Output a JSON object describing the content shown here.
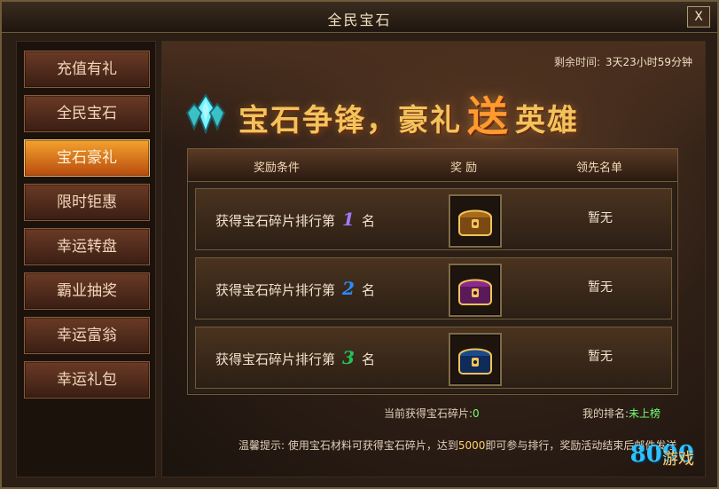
{
  "window": {
    "title": "全民宝石",
    "close_label": "X"
  },
  "sidebar": {
    "items": [
      {
        "label": "充值有礼"
      },
      {
        "label": "全民宝石"
      },
      {
        "label": "宝石豪礼"
      },
      {
        "label": "限时钜惠"
      },
      {
        "label": "幸运转盘"
      },
      {
        "label": "霸业抽奖"
      },
      {
        "label": "幸运富翁"
      },
      {
        "label": "幸运礼包"
      }
    ],
    "active_label": "宝石豪礼"
  },
  "event": {
    "remaining_label": "剩余时间:",
    "remaining_value": "3天23小时59分钟",
    "banner": {
      "left": "宝石争锋，豪礼",
      "emphasis": "送",
      "right": "英雄"
    }
  },
  "rank": {
    "headers": {
      "condition": "奖励条件",
      "reward": "奖 励",
      "leader": "领先名单"
    },
    "rows": [
      {
        "prefix": "获得宝石碎片排行第",
        "rank": "1",
        "suffix": "名",
        "leader": "暂无",
        "reward_icon": "gold-chest-icon",
        "rank_color": "#a07bff"
      },
      {
        "prefix": "获得宝石碎片排行第",
        "rank": "2",
        "suffix": "名",
        "leader": "暂无",
        "reward_icon": "purple-chest-icon",
        "rank_color": "#2a8bff"
      },
      {
        "prefix": "获得宝石碎片排行第",
        "rank": "3",
        "suffix": "名",
        "leader": "暂无",
        "reward_icon": "blue-chest-icon",
        "rank_color": "#22c35a"
      }
    ]
  },
  "footer": {
    "current_label": "当前获得宝石碎片:",
    "current_value": "0",
    "my_rank_label": "我的排名:",
    "my_rank_value": "未上榜",
    "tips_prefix": "温馨提示: 使用宝石材料可获得宝石碎片，达到",
    "tips_value": "5000",
    "tips_suffix": "即可参与排行，奖励活动结束后邮件发送"
  },
  "watermark": {
    "brand": "8090",
    "label": "游戏"
  },
  "colors": {
    "frame": "#6f5a3a",
    "active": "#f4a22e",
    "value_green": "#73ff73"
  }
}
